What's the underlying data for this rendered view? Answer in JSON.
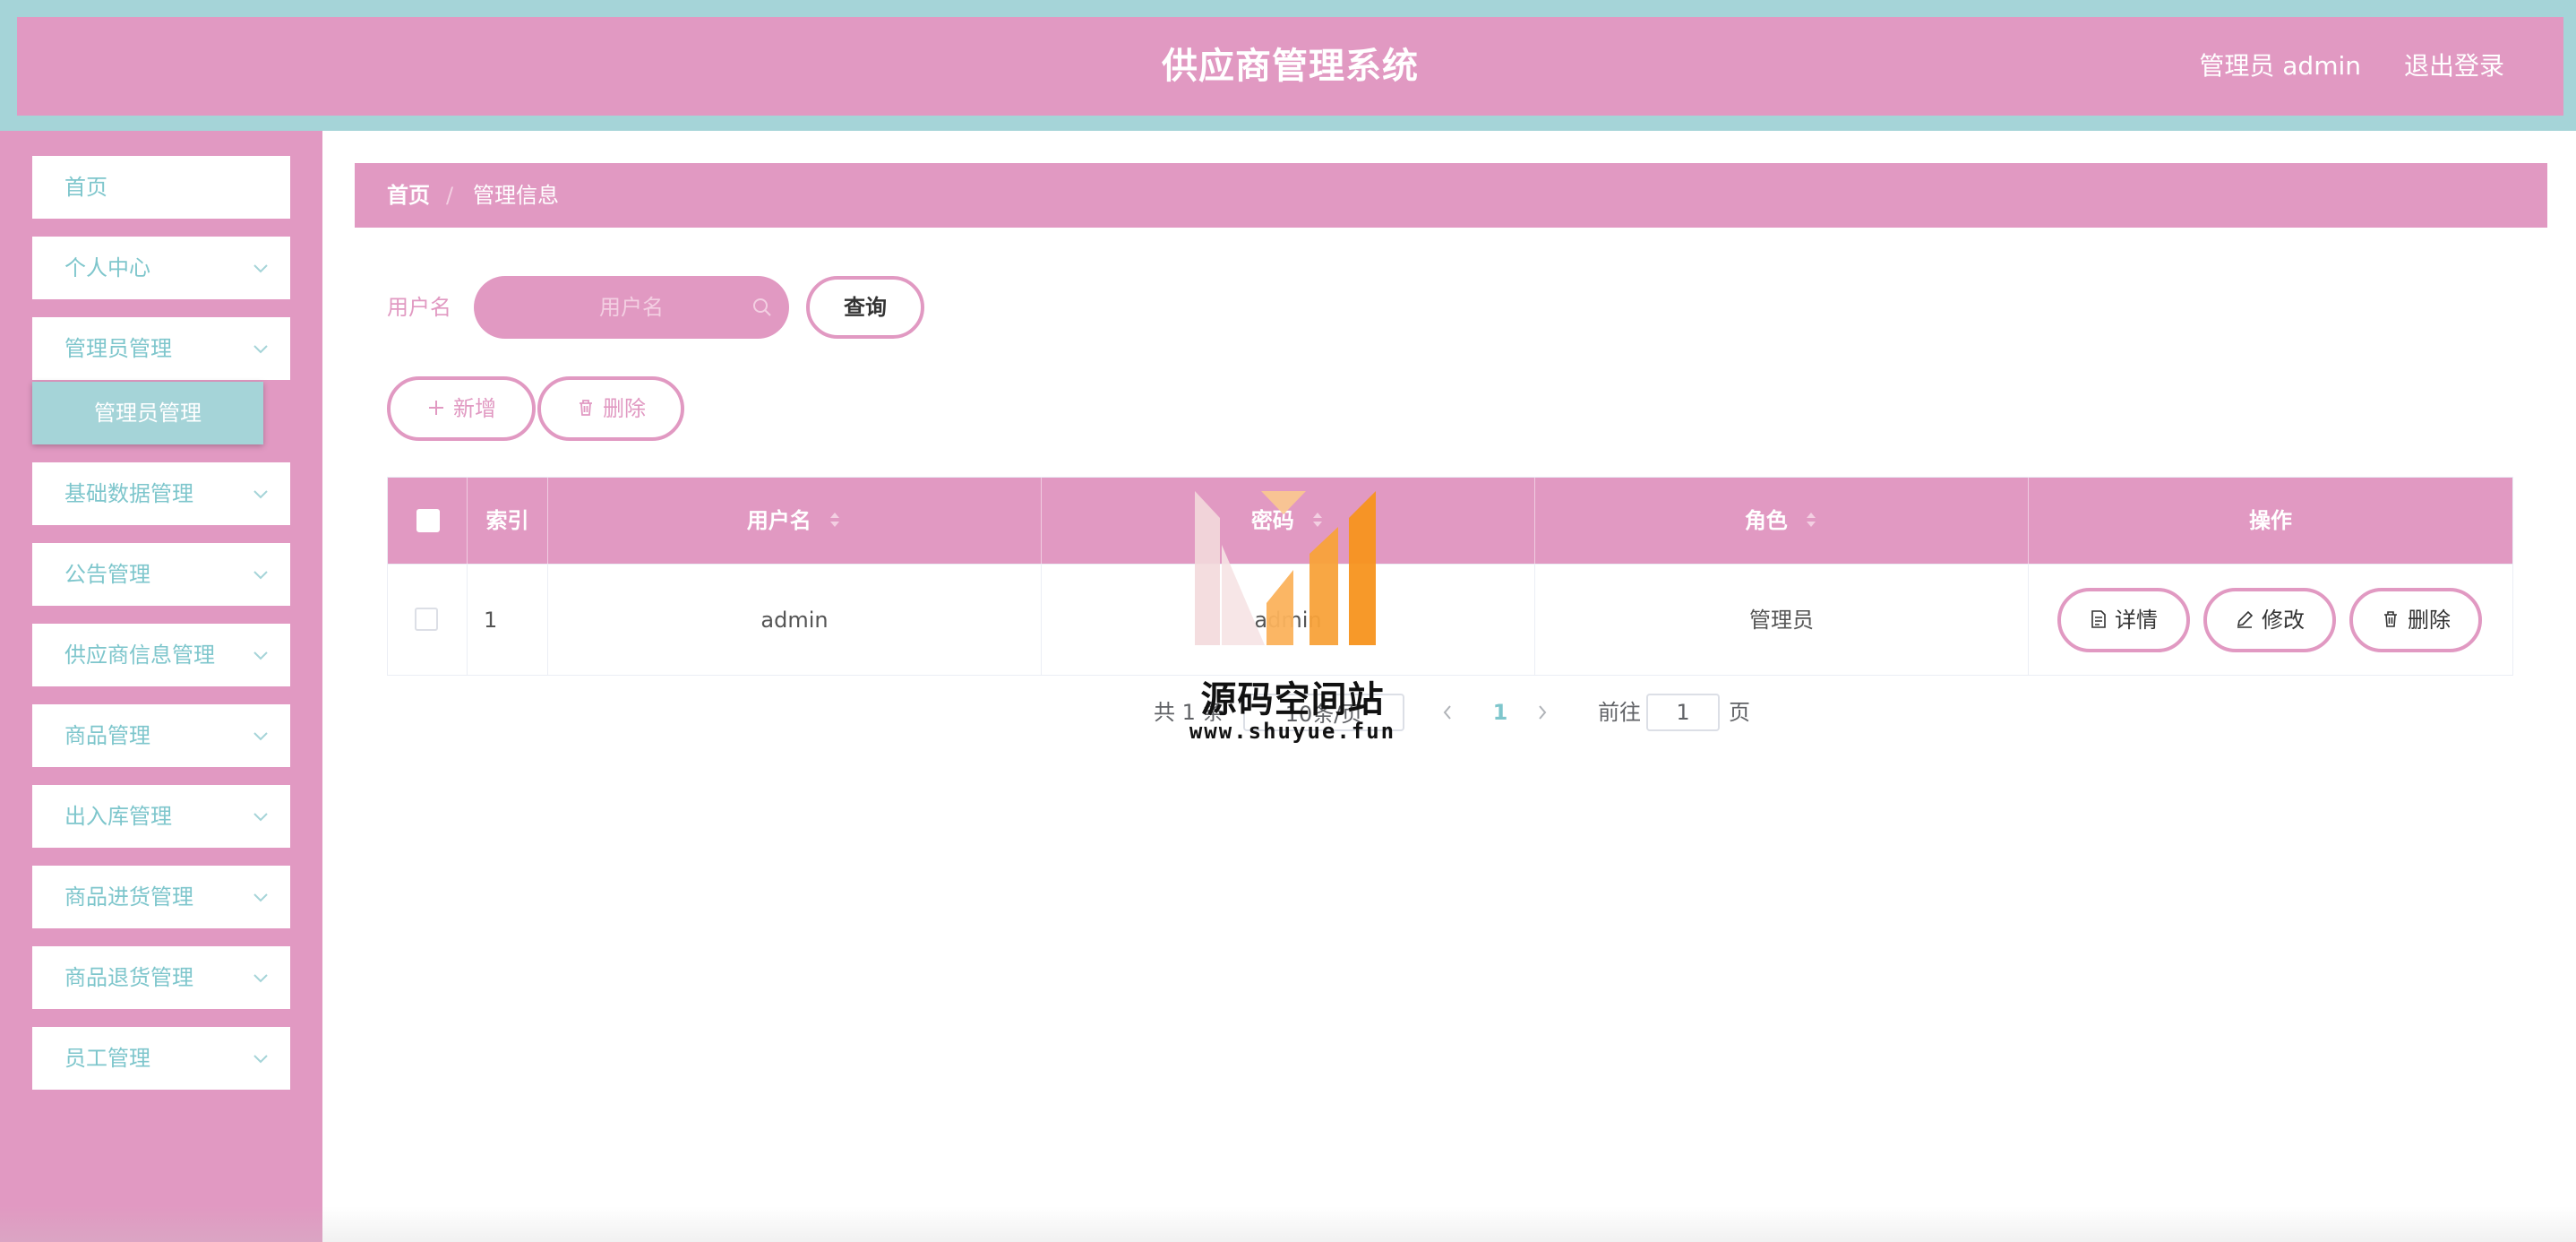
{
  "header": {
    "title": "供应商管理系统",
    "user_info": "管理员 admin",
    "logout_label": "退出登录"
  },
  "sidebar": {
    "items": [
      {
        "label": "首页",
        "has_children": false
      },
      {
        "label": "个人中心",
        "has_children": true
      },
      {
        "label": "管理员管理",
        "has_children": true
      },
      {
        "label": "基础数据管理",
        "has_children": true
      },
      {
        "label": "公告管理",
        "has_children": true
      },
      {
        "label": "供应商信息管理",
        "has_children": true
      },
      {
        "label": "商品管理",
        "has_children": true
      },
      {
        "label": "出入库管理",
        "has_children": true
      },
      {
        "label": "商品进货管理",
        "has_children": true
      },
      {
        "label": "商品退货管理",
        "has_children": true
      },
      {
        "label": "员工管理",
        "has_children": true
      }
    ],
    "active_submenu": {
      "label": "管理员管理"
    }
  },
  "breadcrumb": {
    "home": "首页",
    "separator": "/",
    "current": "管理信息"
  },
  "search": {
    "label": "用户名",
    "placeholder": "用户名",
    "value": "",
    "button_label": "查询"
  },
  "actions": {
    "add_label": "新增",
    "delete_label": "删除"
  },
  "table": {
    "columns": [
      "索引",
      "用户名",
      "密码",
      "角色",
      "操作"
    ],
    "rows": [
      {
        "index": "1",
        "username": "admin",
        "password": "admin",
        "role": "管理员"
      }
    ],
    "row_actions": {
      "detail": "详情",
      "edit": "修改",
      "delete": "删除"
    }
  },
  "pagination": {
    "total_text": "共 1 条",
    "page_size": "10条/页",
    "current_page": "1",
    "goto_label": "前往",
    "goto_value": "1",
    "page_suffix": "页"
  },
  "watermark": {
    "title": "源码空间站",
    "url": "www.shuyue.fun"
  },
  "colors": {
    "primary_pink": "#e199c2",
    "teal": "#a5d4d8",
    "teal_text": "#7ec6cc",
    "watermark_orange": "#f7941d"
  }
}
